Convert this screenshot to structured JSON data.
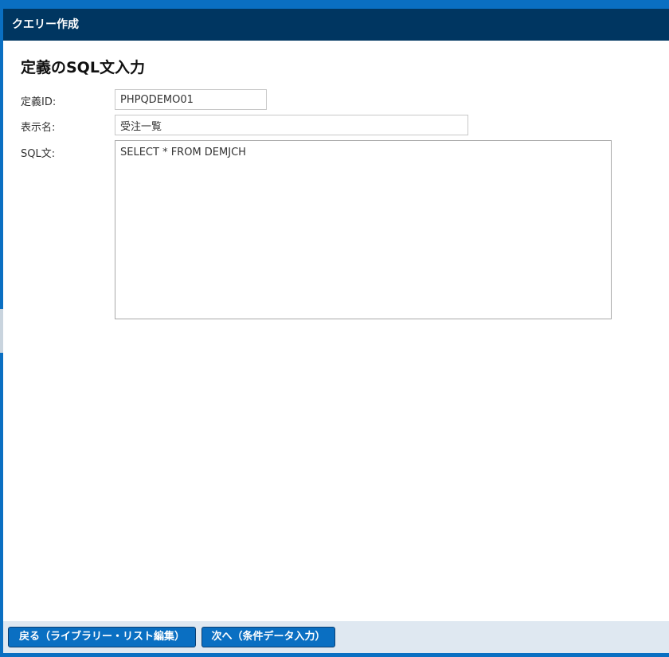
{
  "window": {
    "title": "クエリー作成"
  },
  "form": {
    "heading": "定義のSQL文入力",
    "id_label": "定義ID:",
    "id_value": "PHPQDEMO01",
    "name_label": "表示名:",
    "name_value": "受注一覧",
    "sql_label": "SQL文:",
    "sql_value": "SELECT * FROM DEMJCH"
  },
  "footer": {
    "back_label": "戻る（ライブラリー・リスト編集）",
    "next_label": "次へ（条件データ入力）"
  },
  "colors": {
    "frame_blue": "#0a6fc2",
    "titlebar_navy": "#003661",
    "footer_bg": "#dfe8f1"
  }
}
